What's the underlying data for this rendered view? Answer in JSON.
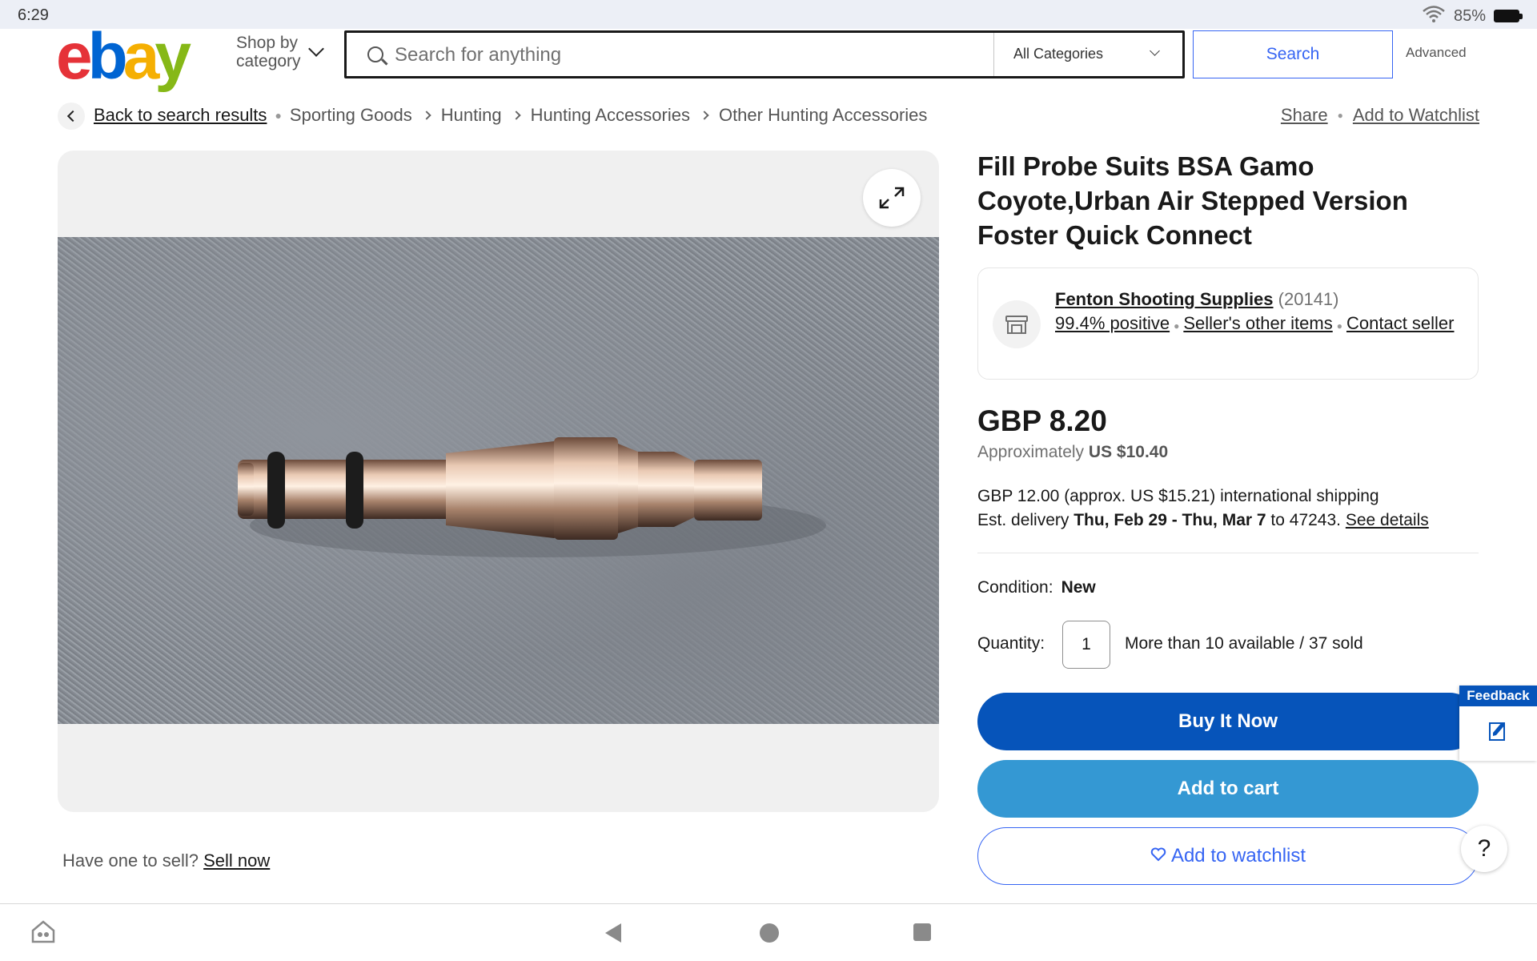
{
  "status_bar": {
    "time": "6:29",
    "battery": "85%"
  },
  "header": {
    "logo": {
      "e": "e",
      "b": "b",
      "a": "a",
      "y": "y"
    },
    "shop_by_line1": "Shop by",
    "shop_by_line2": "category",
    "search_placeholder": "Search for anything",
    "category_select": "All Categories",
    "search_button": "Search",
    "advanced": "Advanced"
  },
  "breadcrumb": {
    "back": "Back to search results",
    "items": [
      "Sporting Goods",
      "Hunting",
      "Hunting Accessories",
      "Other Hunting Accessories"
    ],
    "share": "Share",
    "watchlist": "Add to Watchlist"
  },
  "listing": {
    "title": "Fill Probe Suits BSA Gamo Coyote,Urban Air Stepped Version Foster Quick Connect",
    "seller": {
      "name": "Fenton Shooting Supplies",
      "count": "(20141)",
      "positive": "99.4% positive",
      "other_items": "Seller's other items",
      "contact": "Contact seller"
    },
    "price": "GBP 8.20",
    "approx_prefix": "Approximately",
    "approx_value": "US $10.40",
    "shipping_line": "GBP 12.00 (approx. US $15.21) international shipping",
    "delivery_prefix": "Est. delivery",
    "delivery_dates": "Thu, Feb 29 - Thu, Mar 7",
    "delivery_to": "to 47243.",
    "see_details": "See details",
    "condition_label": "Condition:",
    "condition_value": "New",
    "quantity_label": "Quantity:",
    "quantity_value": "1",
    "availability": "More than 10 available / 37 sold",
    "buy_now": "Buy It Now",
    "add_to_cart": "Add to cart",
    "add_to_watchlist": "Add to watchlist"
  },
  "sell_prompt": {
    "text": "Have one to sell?",
    "link": "Sell now"
  },
  "feedback_tab": "Feedback",
  "help_button": "?",
  "colors": {
    "brand_blue": "#3665f3",
    "buy_button": "#0654ba",
    "cart_button": "#3498d3"
  },
  "icons": [
    "search-icon",
    "chevron-down-icon",
    "back-arrow-icon",
    "breadcrumb-chevron-icon",
    "expand-icon",
    "store-icon",
    "heart-icon",
    "feedback-edit-icon",
    "wifi-icon",
    "battery-icon"
  ]
}
